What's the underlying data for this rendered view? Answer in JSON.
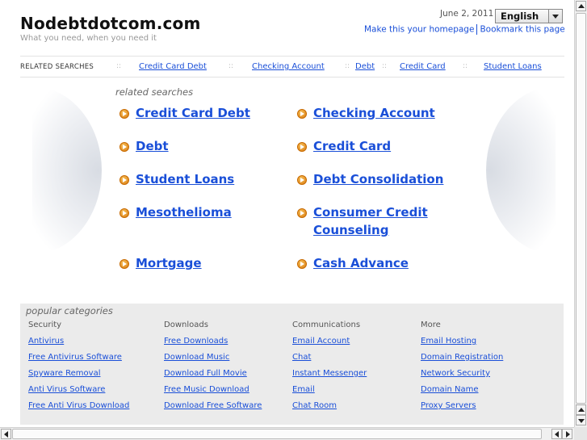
{
  "header": {
    "site_title": "Nodebtdotcom.com",
    "tagline": "What you need, when you need it",
    "date": "June 2, 2011",
    "language": "English",
    "make_homepage": "Make this your homepage",
    "bookmark": "Bookmark this page"
  },
  "related_bar": {
    "label": "RELATED SEARCHES",
    "separator": "::",
    "items": [
      "Credit Card Debt",
      "Checking Account",
      "Debt",
      "Credit Card",
      "Student Loans"
    ]
  },
  "related_searches": {
    "heading": "related searches",
    "links": [
      "Credit Card Debt",
      "Checking Account",
      "Debt",
      "Credit Card",
      "Student Loans",
      "Debt Consolidation",
      "Mesothelioma",
      "Consumer Credit Counseling",
      "Mortgage",
      "Cash Advance"
    ]
  },
  "popular_categories": {
    "heading": "popular categories",
    "columns": [
      {
        "title": "Security",
        "links": [
          "Antivirus",
          "Free Antivirus Software",
          "Spyware Removal",
          "Anti Virus Software",
          "Free Anti Virus Download"
        ]
      },
      {
        "title": "Downloads",
        "links": [
          "Free Downloads",
          "Download Music",
          "Download Full Movie",
          "Free Music Download",
          "Download Free Software"
        ]
      },
      {
        "title": "Communications",
        "links": [
          "Email Account",
          "Chat",
          "Instant Messenger",
          "Email",
          "Chat Room"
        ]
      },
      {
        "title": "More",
        "links": [
          "Email Hosting",
          "Domain Registration",
          "Network Security",
          "Domain Name",
          "Proxy Servers"
        ]
      }
    ]
  },
  "colors": {
    "link": "#1a4fd8",
    "panel": "#ebebeb",
    "arrow": "#e08a1e"
  },
  "icons": {
    "bullet": "arrow-circle-icon"
  }
}
